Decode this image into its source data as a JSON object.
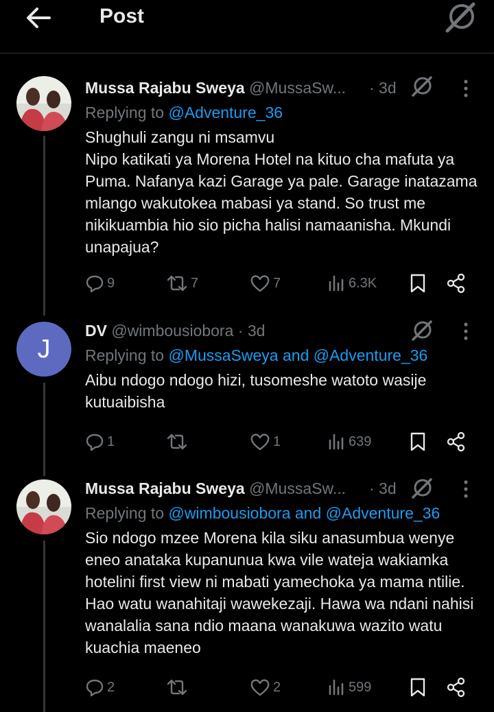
{
  "header": {
    "title": "Post"
  },
  "tweets": [
    {
      "name": "Mussa Rajabu Sweya",
      "handle": "@MussaSw...",
      "time": "· 3d",
      "replying_prefix": "Replying to ",
      "replying_to": "@Adventure_36",
      "text": "Shughuli zangu ni msamvu\nNipo katikati ya  Morena Hotel na kituo cha mafuta ya Puma. Nafanya kazi Garage ya pale. Garage inatazama mlango wakutokea mabasi ya stand. So trust me nikikuambia hio sio picha halisi namaanisha. Mkundi unapajua?",
      "replies": "9",
      "reposts": "7",
      "likes": "7",
      "views": "6.3K"
    },
    {
      "name": "DV",
      "handle": "@wimbousiobora",
      "time": "· 3d",
      "avatar_letter": "J",
      "replying_prefix": "Replying to ",
      "replying_to": "@MussaSweya and @Adventure_36",
      "text": "Aibu ndogo ndogo hizi, tusomeshe watoto wasije kutuaibisha",
      "replies": "1",
      "reposts": "",
      "likes": "1",
      "views": "639"
    },
    {
      "name": "Mussa Rajabu Sweya",
      "handle": "@MussaSw...",
      "time": "· 3d",
      "replying_prefix": "Replying to ",
      "replying_to": "@wimbousiobora and @Adventure_36",
      "text": "Sio ndogo mzee Morena kila siku anasumbua wenye eneo anataka kupanunua kwa vile wateja wakiamka hotelini first view ni mabati yamechoka ya mama ntilie. Hao watu wanahitaji wawekezaji. Hawa wa ndani nahisi wanalalia sana ndio maana wanakuwa wazito watu kuachia maeneo",
      "replies": "2",
      "reposts": "",
      "likes": "2",
      "views": "599"
    }
  ],
  "colors": {
    "background": "#000000",
    "text": "#e7e9ea",
    "muted": "#71767b",
    "link": "#1d9bf0",
    "avatar_j": "#5c6bc0"
  },
  "icons": [
    "back-arrow-icon",
    "grok-icon",
    "more-icon",
    "reply-icon",
    "repost-icon",
    "like-icon",
    "views-icon",
    "bookmark-icon",
    "share-icon"
  ]
}
